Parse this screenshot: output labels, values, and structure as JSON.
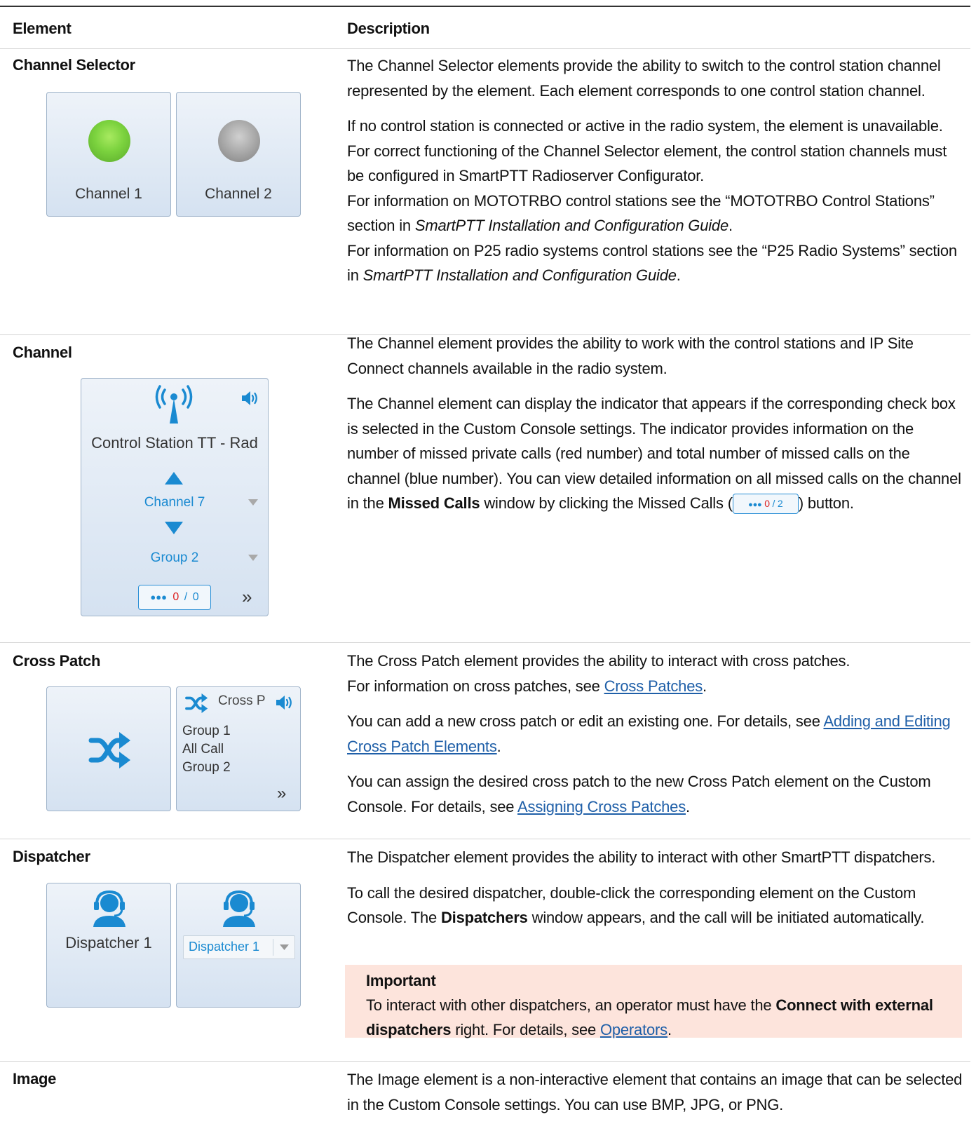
{
  "table": {
    "header_element": "Element",
    "header_description": "Description"
  },
  "rows": {
    "channel_selector": {
      "name": "Channel Selector",
      "tile1_label": "Channel 1",
      "tile2_label": "Channel 2",
      "p1": "The Channel Selector elements provide the ability to switch to the control station channel represented by the element. Each element corresponds to one control station channel.",
      "p2_a": "If no control station is connected or active in the radio system, the element is unavailable. For correct functioning of the Channel Selector element, the control station channels must be configured in SmartPTT Radioserver Configurator.",
      "p2_b": "For information on MOTOTRBO control stations see the “MOTOTRBO Control Stations” section in ",
      "p2_b_italic": "SmartPTT Installation and Configuration Guide",
      "p2_c": "For information on P25 radio systems control stations see the “P25 Radio Systems” section in ",
      "p2_c_italic": "SmartPTT Installation and Configuration Guide",
      "period": "."
    },
    "channel": {
      "name": "Channel",
      "tile_title": "Control Station TT - Rad",
      "channel_value": "Channel 7",
      "group_value": "Group 2",
      "missed_red": "0",
      "missed_sep": "/",
      "missed_blue": "0",
      "more": "»",
      "p1": "The Channel element provides the ability to work with the control stations and IP Site Connect channels available in the radio system.",
      "p2_a": "The Channel element can display the indicator that appears if the corresponding check box is selected in the Custom Console settings. The indicator provides information on the number of missed private calls (red number) and total number of missed calls on the channel (blue number). You can view detailed information on all missed calls on the channel in the ",
      "p2_bold": "Missed Calls",
      "p2_b": " window by clicking the Missed Calls (",
      "inline_red": "0",
      "inline_sep": "/",
      "inline_blue": "2",
      "p2_c": ") button."
    },
    "cross_patch": {
      "name": "Cross Patch",
      "tile2_title": "Cross P",
      "members": [
        "Group 1",
        "All Call",
        "Group 2"
      ],
      "more": "»",
      "p1_a": "The Cross Patch element provides the ability to interact with cross patches.",
      "p1_b": "For information on cross patches, see ",
      "p1_link": "Cross Patches",
      "p2_a": "You can add a new cross patch or edit an existing one. For details, see ",
      "p2_link": "Adding and Editing Cross Patch Elements",
      "p3_a": "You can assign the desired cross patch to the new Cross Patch element on the Custom Console. For details, see ",
      "p3_link": "Assigning Cross Patches",
      "period": "."
    },
    "dispatcher": {
      "name": "Dispatcher",
      "tile1_label": "Dispatcher 1",
      "dropdown_value": "Dispatcher 1",
      "p1": "The Dispatcher element provides the ability to interact with other SmartPTT dispatchers.",
      "p2_a": "To call the desired dispatcher, double-click the corresponding element on the Custom Console. The ",
      "p2_bold": "Dispatchers",
      "p2_b": " window appears, and the call will be initiated automatically.",
      "important_title": "Important",
      "imp_a": "To interact with other dispatchers, an operator must have the ",
      "imp_bold": "Connect with external dispatchers",
      "imp_b": " right. For details, see ",
      "imp_link": "Operators",
      "period": "."
    },
    "image": {
      "name": "Image",
      "p1": "The Image element is a non-interactive element that contains an image that can be selected in the Custom Console settings. You can use BMP, JPG, or PNG."
    }
  },
  "colors": {
    "link": "#1f5fa8",
    "accent_blue": "#1a8ad1",
    "important_bg": "#fde4dc",
    "tile_border": "#9fb3c9"
  }
}
